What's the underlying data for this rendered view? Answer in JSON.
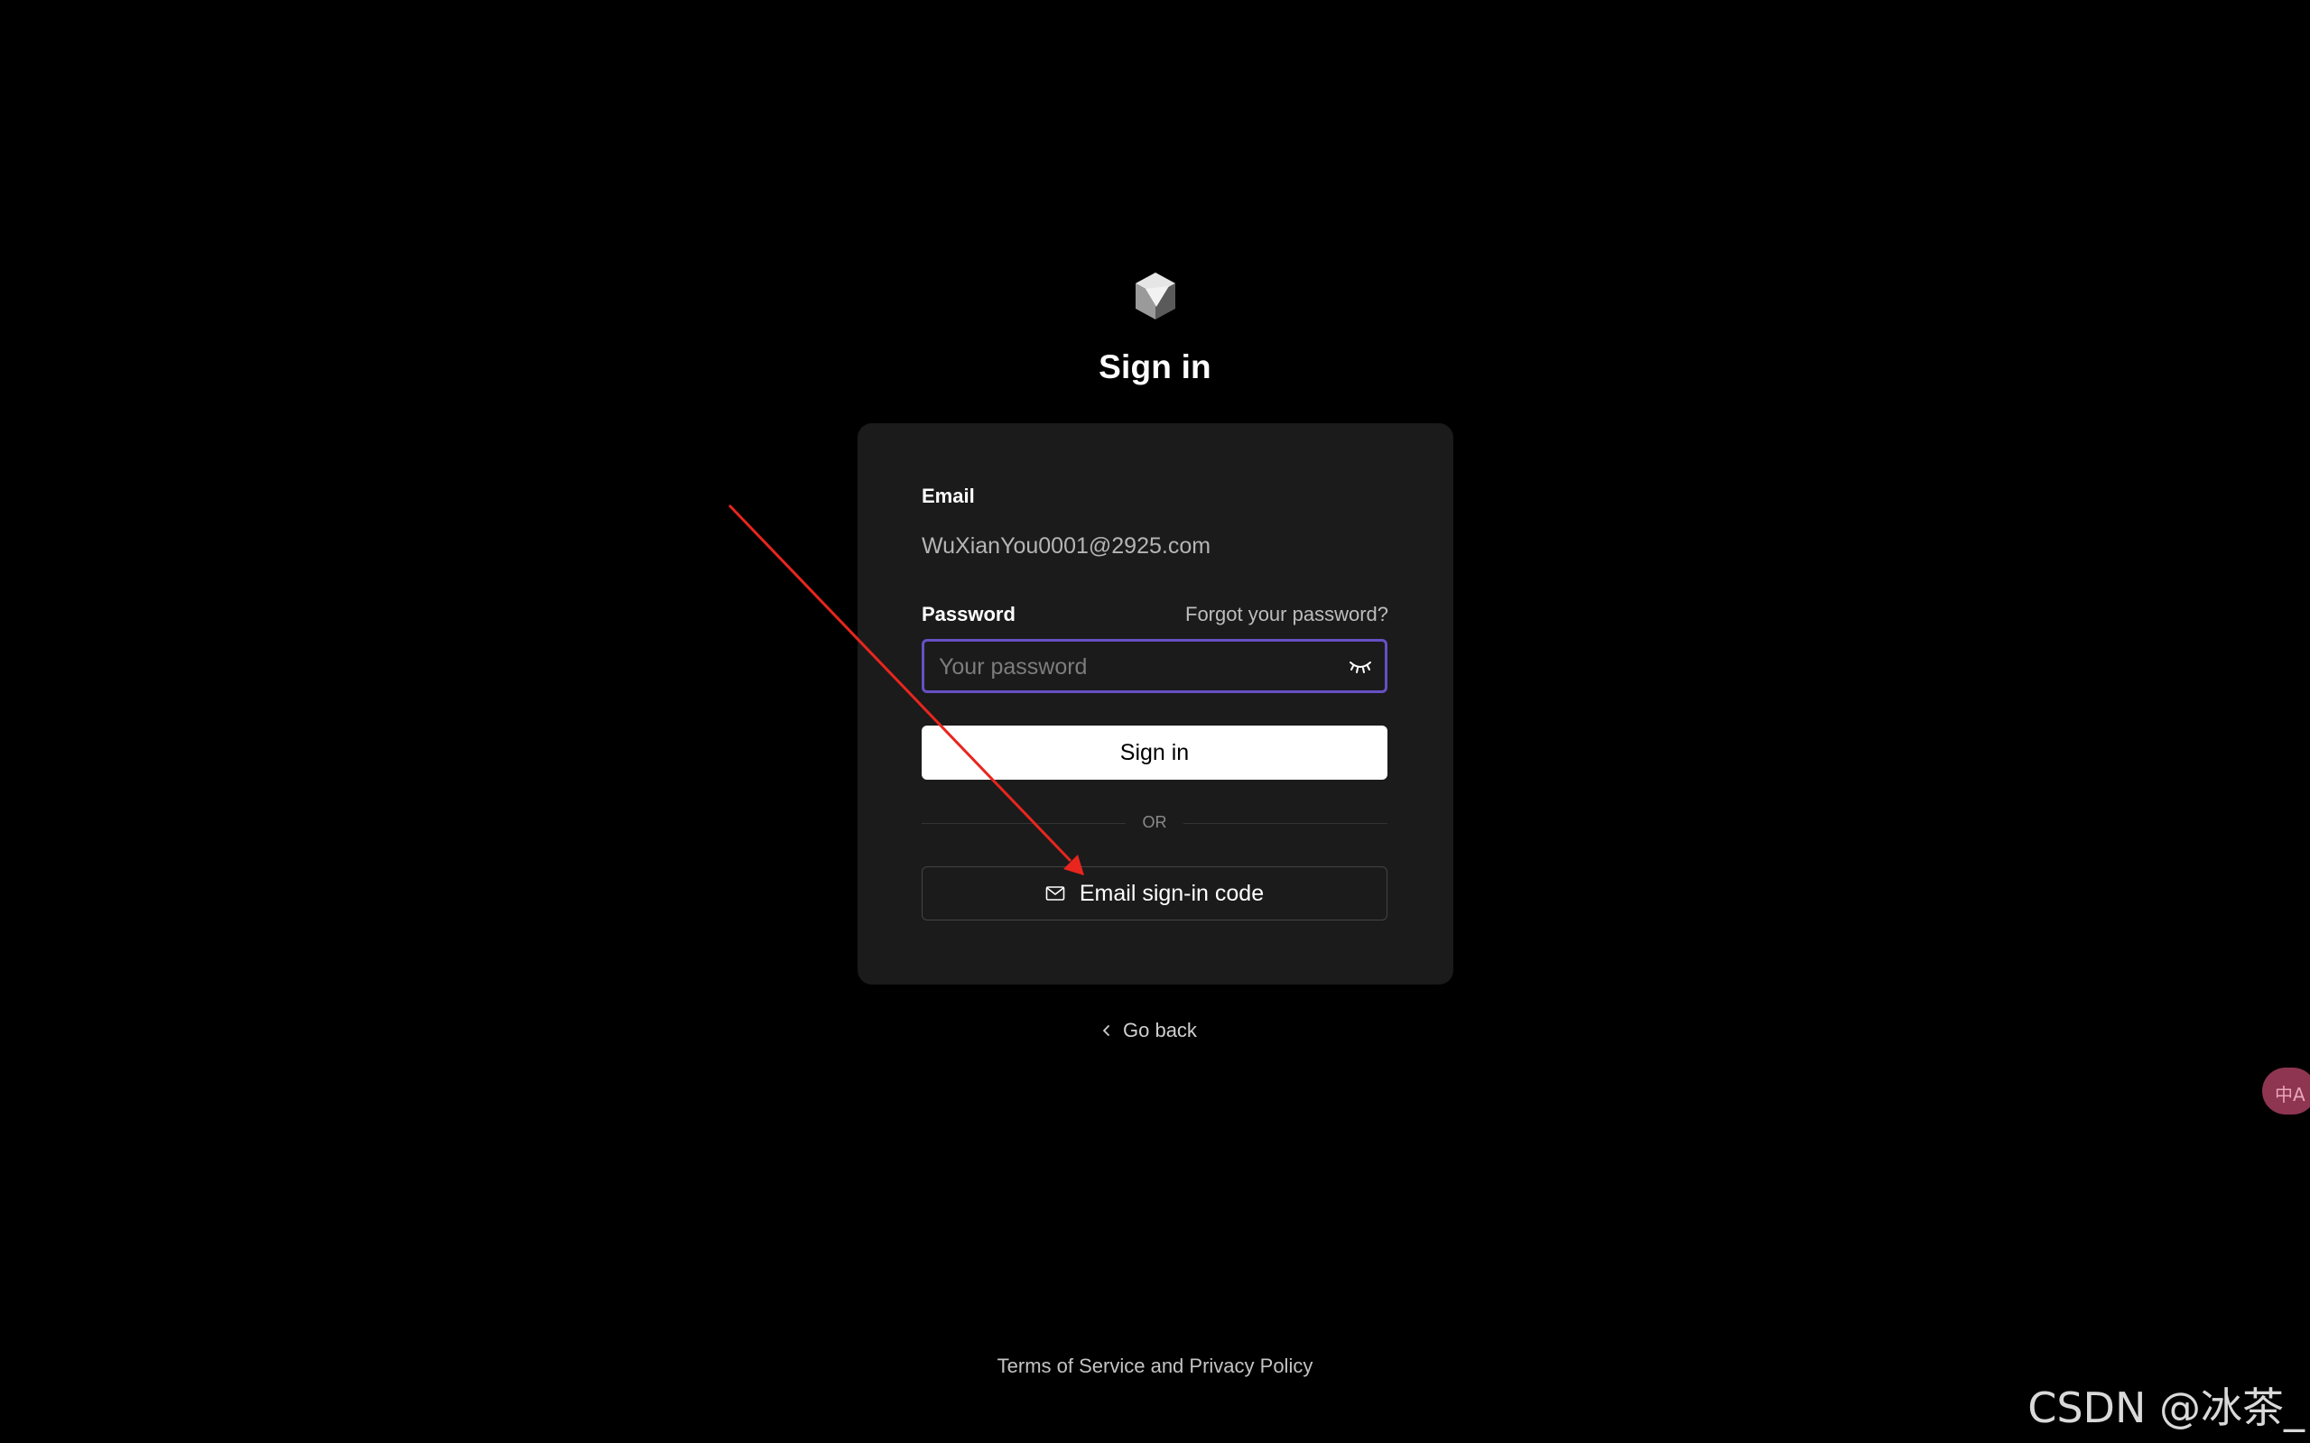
{
  "header": {
    "logo_icon": "cube-logo-icon",
    "title": "Sign in"
  },
  "form": {
    "email_label": "Email",
    "email_value": "WuXianYou0001@2925.com",
    "password_label": "Password",
    "forgot_link": "Forgot your password?",
    "password_placeholder": "Your password",
    "password_value": "",
    "password_toggle_icon": "eye-closed-icon",
    "signin_button": "Sign in",
    "divider_text": "OR",
    "email_code_icon": "mail-icon",
    "email_code_button": "Email sign-in code"
  },
  "nav": {
    "go_back_icon": "chevron-left-icon",
    "go_back": "Go back"
  },
  "footer": {
    "terms": "Terms of Service and Privacy Policy"
  },
  "overlay": {
    "translate_widget_icon": "translate-icon",
    "translate_glyph": "中A",
    "watermark": "CSDN @冰茶_",
    "annotation_arrow_color": "#e8261e"
  },
  "colors": {
    "background": "#000000",
    "card": "#1b1b1b",
    "focus_border": "#6650c4",
    "primary_button": "#ffffff"
  }
}
